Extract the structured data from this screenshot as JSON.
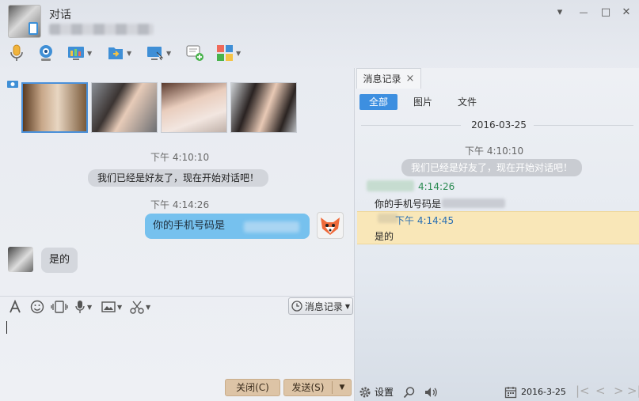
{
  "window": {
    "title": "对话",
    "controls": {
      "menu": "▾",
      "minimize": "—",
      "maximize": "□",
      "close": "✕"
    }
  },
  "toolbar": {
    "items": [
      {
        "icon": "microphone-icon"
      },
      {
        "icon": "webcam-icon"
      },
      {
        "icon": "screen-share-icon"
      },
      {
        "icon": "file-transfer-icon"
      },
      {
        "icon": "remote-desktop-icon"
      },
      {
        "icon": "create-group-icon"
      },
      {
        "icon": "apps-grid-icon"
      }
    ]
  },
  "chat": {
    "messages": [
      {
        "kind": "time",
        "text": "下午 4:10:10"
      },
      {
        "kind": "system",
        "text": "我们已经是好友了，现在开始对话吧！"
      },
      {
        "kind": "time",
        "text": "下午 4:14:26"
      },
      {
        "kind": "outgoing",
        "text": "你的手机号码是"
      },
      {
        "kind": "incoming",
        "text": "是的"
      }
    ]
  },
  "input_toolbar": {
    "history_label": "消息记录"
  },
  "buttons": {
    "close_label": "关闭(C)",
    "send_label": "发送(S)"
  },
  "history": {
    "tab_label": "消息记录",
    "tab_close": "×",
    "filters": [
      "全部",
      "图片",
      "文件"
    ],
    "date_header": "2016-03-25",
    "entries": [
      {
        "time": "下午 4:10:10",
        "text": "我们已经是好友了，现在开始对话吧！"
      },
      {
        "time": "4:14:26",
        "text": "你的手机号码是"
      },
      {
        "time": "下午 4:14:45",
        "text": "是的"
      }
    ],
    "bottom": {
      "settings_label": "设置",
      "date": "2016-3-25"
    }
  },
  "colors": {
    "accent": "#3d8fe0",
    "outgoing_bubble": "#76c1ee",
    "highlight_row": "#f9e7b8",
    "send_button": "#ddc4a6"
  }
}
